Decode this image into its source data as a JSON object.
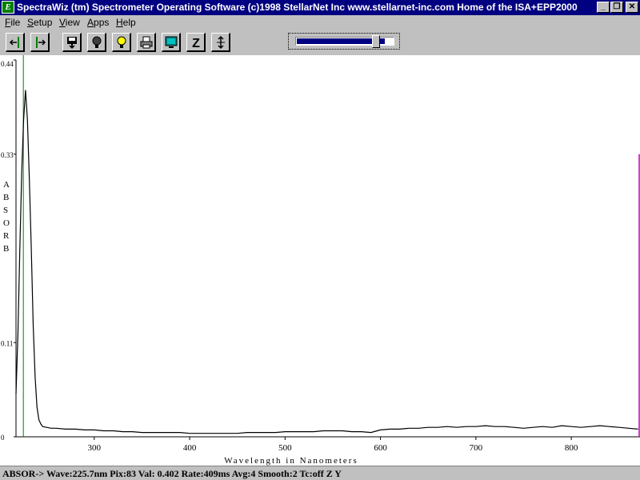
{
  "window": {
    "title": "SpectraWiz (tm) Spectrometer Operating Software   (c)1998 StellarNet Inc  www.stellarnet-inc.com  Home of the ISA+EPP2000",
    "app_icon_glyph": "E",
    "minimize_glyph": "_",
    "restore_glyph": "❐",
    "close_glyph": "✕"
  },
  "menu": {
    "items": [
      {
        "label": "File"
      },
      {
        "label": "Setup"
      },
      {
        "label": "View"
      },
      {
        "label": "Apps"
      },
      {
        "label": "Help"
      }
    ]
  },
  "toolbar": {
    "buttons": [
      {
        "icon": "shift-left-icon"
      },
      {
        "icon": "shift-right-icon"
      },
      {
        "icon": "save-disk-icon"
      },
      {
        "icon": "dark-bulb-icon"
      },
      {
        "icon": "light-bulb-icon"
      },
      {
        "icon": "print-icon"
      },
      {
        "icon": "monitor-icon"
      },
      {
        "icon": "zoom-z-icon"
      },
      {
        "icon": "autoscale-icon"
      }
    ],
    "zoom_z_glyph": "Z",
    "slider_fraction": 0.92
  },
  "chart_data": {
    "type": "line",
    "xlabel": "Wavelength in Nanometers",
    "ylabel": "ABSORB",
    "xlim": [
      218,
      872
    ],
    "ylim": [
      0,
      0.44
    ],
    "x_ticks": [
      300,
      400,
      500,
      600,
      700,
      800
    ],
    "y_ticks": [
      0,
      0.11,
      0.33,
      0.44
    ],
    "y_tick_labels": [
      "0",
      "0.11",
      "0.33",
      "0.44"
    ],
    "cursor_wavelength": 225.7,
    "colors": {
      "trace": "#000000",
      "cursor": "#008000",
      "right_marker": "#c000c0"
    },
    "series": [
      {
        "x": [
          218,
          220,
          222,
          224,
          226,
          228,
          230,
          232,
          234,
          236,
          238,
          240,
          242,
          244,
          246,
          250,
          255,
          260,
          270,
          280,
          290,
          300,
          310,
          320,
          330,
          340,
          350,
          360,
          370,
          380,
          390,
          400,
          410,
          420,
          430,
          440,
          450,
          460,
          470,
          480,
          490,
          500,
          510,
          520,
          530,
          540,
          550,
          560,
          570,
          580,
          590,
          600,
          610,
          620,
          630,
          640,
          650,
          660,
          670,
          680,
          690,
          700,
          710,
          720,
          730,
          740,
          750,
          760,
          770,
          780,
          790,
          800,
          810,
          820,
          830,
          840,
          850,
          860,
          870
        ],
        "y": [
          0.05,
          0.12,
          0.22,
          0.31,
          0.37,
          0.405,
          0.37,
          0.3,
          0.22,
          0.13,
          0.07,
          0.035,
          0.02,
          0.015,
          0.012,
          0.011,
          0.01,
          0.01,
          0.009,
          0.009,
          0.008,
          0.008,
          0.007,
          0.007,
          0.006,
          0.006,
          0.005,
          0.005,
          0.005,
          0.005,
          0.005,
          0.004,
          0.004,
          0.004,
          0.004,
          0.004,
          0.004,
          0.005,
          0.005,
          0.005,
          0.005,
          0.006,
          0.006,
          0.006,
          0.006,
          0.007,
          0.007,
          0.007,
          0.006,
          0.006,
          0.005,
          0.008,
          0.009,
          0.009,
          0.01,
          0.01,
          0.011,
          0.011,
          0.012,
          0.011,
          0.012,
          0.012,
          0.013,
          0.012,
          0.012,
          0.011,
          0.01,
          0.011,
          0.012,
          0.011,
          0.013,
          0.012,
          0.011,
          0.012,
          0.013,
          0.012,
          0.011,
          0.01,
          0.009
        ]
      }
    ]
  },
  "status": {
    "text": "ABSOR->  Wave:225.7nm  Pix:83  Val:  0.402  Rate:409ms  Avg:4  Smooth:2  Tc:off  Z  Y"
  }
}
